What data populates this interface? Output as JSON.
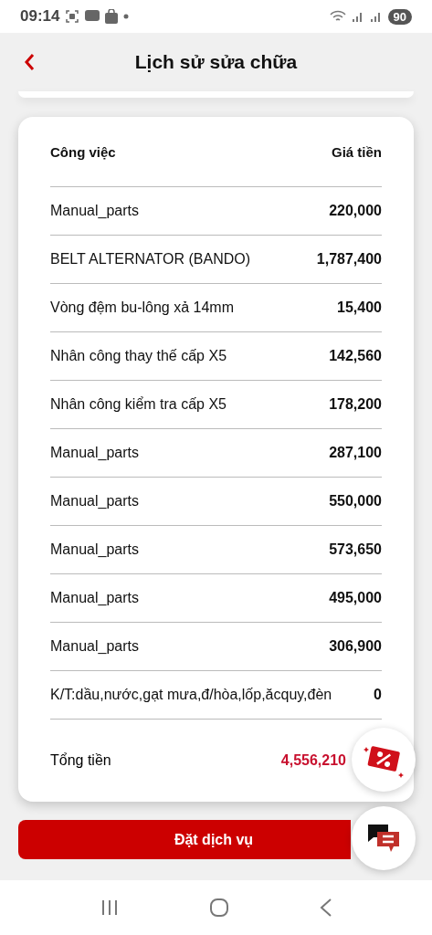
{
  "status_bar": {
    "time": "09:14",
    "battery": "90"
  },
  "header": {
    "title": "Lịch sử sửa chữa"
  },
  "table": {
    "columns": [
      "Công việc",
      "Giá tiền"
    ],
    "rows": [
      {
        "name": "Manual_parts",
        "price": "220,000"
      },
      {
        "name": "BELT ALTERNATOR (BANDO)",
        "price": "1,787,400"
      },
      {
        "name": "Vòng đệm bu-lông xả 14mm",
        "price": "15,400"
      },
      {
        "name": "Nhân công thay thế cấp X5",
        "price": "142,560"
      },
      {
        "name": "Nhân công kiểm tra cấp X5",
        "price": "178,200"
      },
      {
        "name": "Manual_parts",
        "price": "287,100"
      },
      {
        "name": "Manual_parts",
        "price": "550,000"
      },
      {
        "name": "Manual_parts",
        "price": "573,650"
      },
      {
        "name": "Manual_parts",
        "price": "495,000"
      },
      {
        "name": "Manual_parts",
        "price": "306,900"
      },
      {
        "name": "K/T:dầu,nước,gạt mưa,đ/hòa,lốp,ăcquy,đèn",
        "price": "0"
      }
    ]
  },
  "total": {
    "label": "Tổng tiền",
    "value": "4,556,210"
  },
  "button": "Đặt dịch vụ"
}
